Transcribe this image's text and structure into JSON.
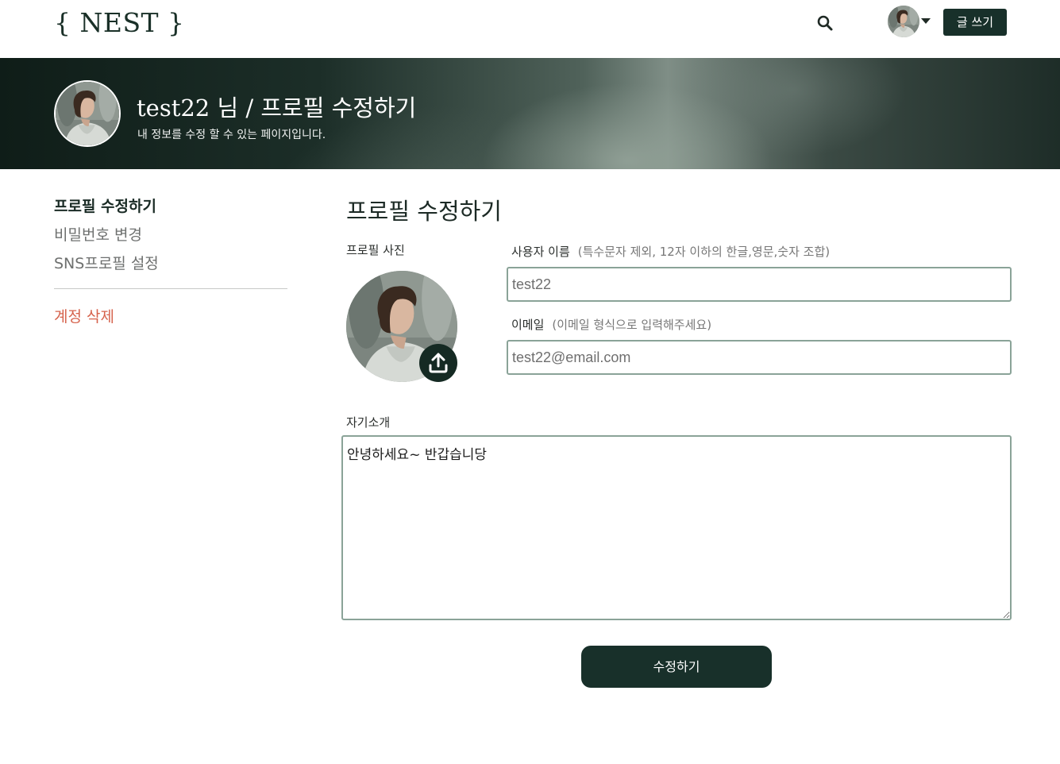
{
  "header": {
    "logo": "{ NEST }",
    "write_button": "글 쓰기"
  },
  "banner": {
    "title": "test22 님 / 프로필 수정하기",
    "subtitle": "내 정보를 수정 할 수 있는 페이지입니다."
  },
  "sidebar": {
    "items": [
      {
        "label": "프로필 수정하기"
      },
      {
        "label": "비밀번호 변경"
      },
      {
        "label": "SNS프로필 설정"
      }
    ],
    "delete_account": "계정 삭제"
  },
  "main": {
    "title": "프로필 수정하기",
    "photo_label": "프로필 사진",
    "username": {
      "label": "사용자 이름",
      "hint": "(특수문자 제외, 12자 이하의 한글,영문,숫자 조합)",
      "value": "test22"
    },
    "email": {
      "label": "이메일",
      "hint": "(이메일 형식으로 입력해주세요)",
      "value": "test22@email.com"
    },
    "intro": {
      "label": "자기소개",
      "value": "안녕하세요~ 반갑습니당"
    },
    "submit_button": "수정하기"
  },
  "icons": {
    "search": "search-icon",
    "upload": "upload-icon",
    "caret": "caret-down-icon"
  },
  "colors": {
    "brand_dark": "#18302a",
    "danger": "#d6634d",
    "input_border": "#8aa398"
  }
}
